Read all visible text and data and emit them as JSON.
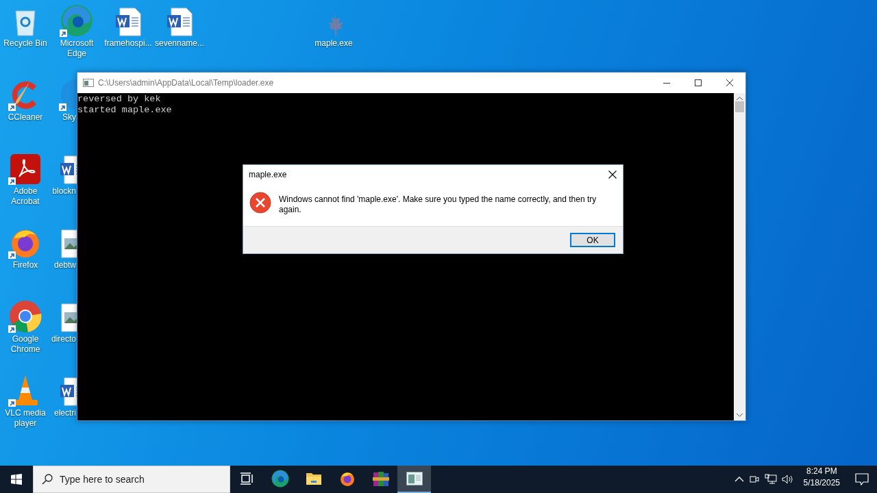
{
  "desktop_icons": [
    {
      "label": "Recycle Bin",
      "kind": "recycle",
      "shortcut": false
    },
    {
      "label": "CCleaner",
      "kind": "ccleaner",
      "shortcut": true
    },
    {
      "label": "Adobe Acrobat",
      "kind": "acrobat",
      "shortcut": true
    },
    {
      "label": "Firefox",
      "kind": "firefox",
      "shortcut": true
    },
    {
      "label": "Google Chrome",
      "kind": "chrome",
      "shortcut": true
    },
    {
      "label": "VLC media player",
      "kind": "vlc",
      "shortcut": true
    },
    {
      "label": "Microsoft Edge",
      "kind": "edge",
      "shortcut": true
    },
    {
      "label": "Sky",
      "kind": "skype",
      "shortcut": true
    },
    {
      "label": "blockn",
      "kind": "word",
      "shortcut": false
    },
    {
      "label": "debtw",
      "kind": "image",
      "shortcut": false
    },
    {
      "label": "directo",
      "kind": "image",
      "shortcut": false
    },
    {
      "label": "electri",
      "kind": "word",
      "shortcut": false
    },
    {
      "label": "framehospi...",
      "kind": "word",
      "shortcut": false
    },
    {
      "label": "sevenname...",
      "kind": "word",
      "shortcut": false
    },
    {
      "label": "maple.exe",
      "kind": "maple",
      "shortcut": false
    }
  ],
  "console_window": {
    "title": "C:\\Users\\admin\\AppData\\Local\\Temp\\loader.exe",
    "lines": [
      "reversed by kek",
      "started maple.exe"
    ]
  },
  "dialog": {
    "title": "maple.exe",
    "message": "Windows cannot find 'maple.exe'. Make sure you typed the name correctly, and then try again.",
    "button": "OK"
  },
  "taskbar": {
    "search_placeholder": "Type here to search",
    "apps": [
      {
        "kind": "taskview",
        "active": false
      },
      {
        "kind": "edge",
        "active": false
      },
      {
        "kind": "explorer",
        "active": false
      },
      {
        "kind": "firefox",
        "active": false
      },
      {
        "kind": "winrar",
        "active": false
      },
      {
        "kind": "console",
        "active": true
      }
    ],
    "time": "8:24 PM",
    "date": "5/18/2025"
  }
}
